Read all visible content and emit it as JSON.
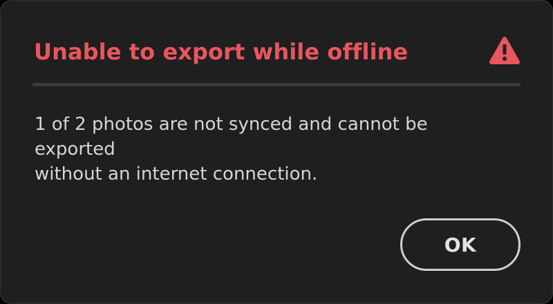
{
  "dialog": {
    "title": "Unable to export while offline",
    "icon": "warning-triangle-icon",
    "message_line1": "1 of 2 photos are not synced and cannot be exported",
    "message_line2": "without an internet connection.",
    "ok_label": "OK"
  },
  "colors": {
    "background": "#1f1f1f",
    "title": "#e8565f",
    "icon": "#e8565f",
    "text": "#d6d6d6",
    "button_border": "#cfcfcf",
    "divider": "#3a3a3a"
  }
}
